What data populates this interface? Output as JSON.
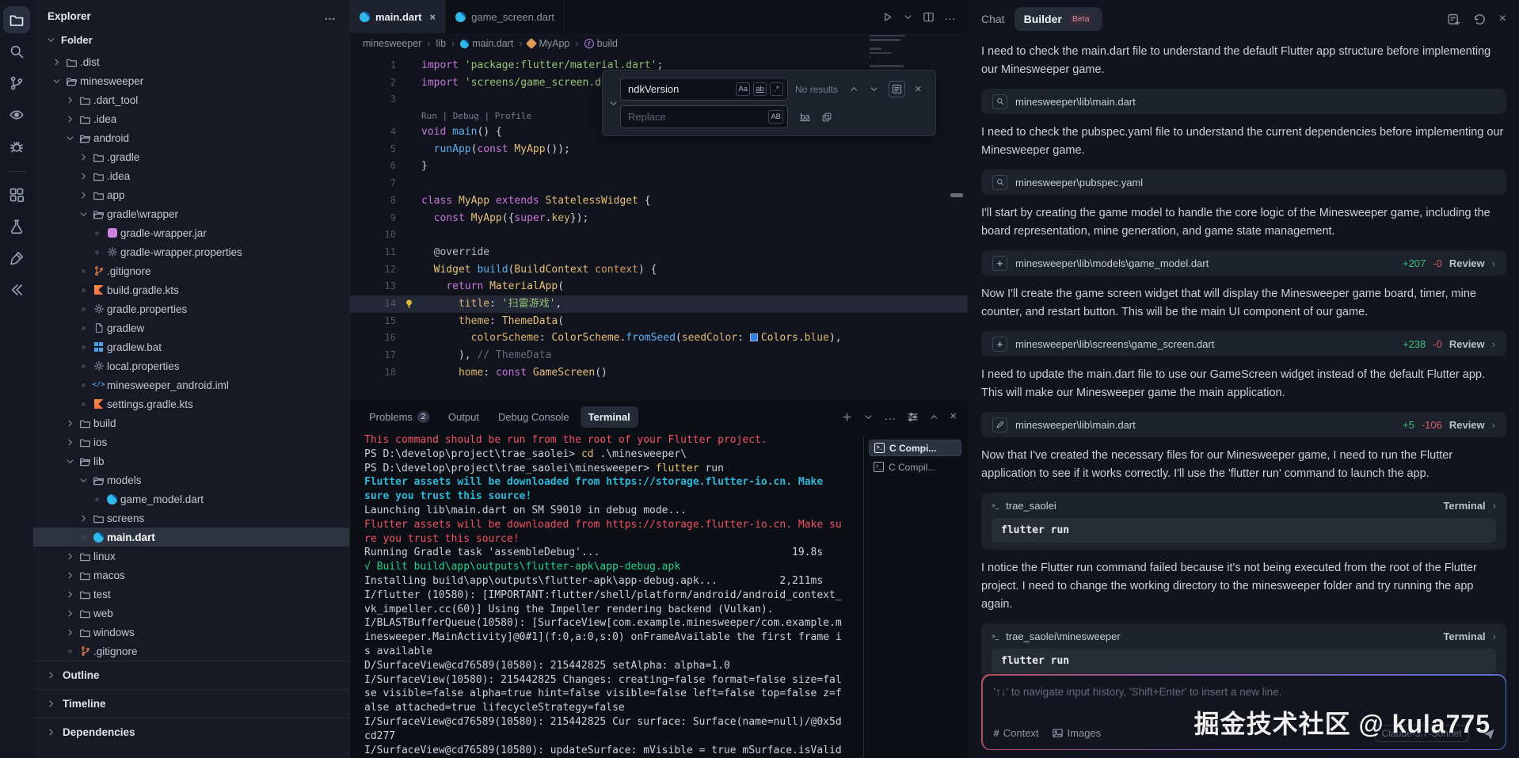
{
  "activity_bar": {
    "icons": [
      {
        "name": "explorer",
        "glyph": "files",
        "active": true
      },
      {
        "name": "search",
        "glyph": "search"
      },
      {
        "name": "source-control",
        "glyph": "git"
      },
      {
        "name": "preview",
        "glyph": "scan"
      },
      {
        "name": "debug",
        "glyph": "bug"
      },
      {
        "name": "divider",
        "glyph": "divider"
      },
      {
        "name": "extensions",
        "glyph": "grid"
      },
      {
        "name": "test-lab",
        "glyph": "flask"
      },
      {
        "name": "ai-stamp",
        "glyph": "stamp"
      },
      {
        "name": "flutter",
        "glyph": "flutchev"
      }
    ]
  },
  "sidebar": {
    "title": "Explorer",
    "more_label": "…",
    "section": "Folder",
    "tree": [
      {
        "d": 1,
        "icon": "folder",
        "chev": "r",
        "label": ".dist"
      },
      {
        "d": 1,
        "icon": "folderOpen",
        "chev": "d",
        "label": "minesweeper"
      },
      {
        "d": 2,
        "icon": "folder",
        "chev": "r",
        "label": ".dart_tool"
      },
      {
        "d": 2,
        "icon": "folder",
        "chev": "r",
        "label": ".idea"
      },
      {
        "d": 2,
        "icon": "folderOpen",
        "chev": "d",
        "label": "android"
      },
      {
        "d": 3,
        "icon": "folder",
        "chev": "r",
        "label": ".gradle"
      },
      {
        "d": 3,
        "icon": "folder",
        "chev": "r",
        "label": ".idea"
      },
      {
        "d": 3,
        "icon": "folder",
        "chev": "r",
        "label": "app"
      },
      {
        "d": 3,
        "icon": "folderOpen",
        "chev": "d",
        "label": "gradle\\wrapper"
      },
      {
        "d": 4,
        "icon": "jar",
        "dot": true,
        "label": "gradle-wrapper.jar"
      },
      {
        "d": 4,
        "icon": "gear",
        "dot": true,
        "label": "gradle-wrapper.properties"
      },
      {
        "d": 3,
        "icon": "gitf",
        "dot": true,
        "label": ".gitignore"
      },
      {
        "d": 3,
        "icon": "kotlin",
        "dot": true,
        "label": "build.gradle.kts"
      },
      {
        "d": 3,
        "icon": "gear",
        "dot": true,
        "label": "gradle.properties"
      },
      {
        "d": 3,
        "icon": "file",
        "dot": true,
        "label": "gradlew"
      },
      {
        "d": 3,
        "icon": "win",
        "dot": true,
        "label": "gradlew.bat"
      },
      {
        "d": 3,
        "icon": "gear",
        "dot": true,
        "label": "local.properties"
      },
      {
        "d": 3,
        "icon": "codef",
        "dot": true,
        "label": "minesweeper_android.iml"
      },
      {
        "d": 3,
        "icon": "kotlin",
        "dot": true,
        "label": "settings.gradle.kts"
      },
      {
        "d": 2,
        "icon": "folder",
        "chev": "r",
        "label": "build"
      },
      {
        "d": 2,
        "icon": "folder",
        "chev": "r",
        "label": "ios"
      },
      {
        "d": 2,
        "icon": "folderOpen",
        "chev": "d",
        "label": "lib"
      },
      {
        "d": 3,
        "icon": "folderOpen",
        "chev": "d",
        "label": "models"
      },
      {
        "d": 4,
        "icon": "dart",
        "dot": true,
        "label": "game_model.dart"
      },
      {
        "d": 3,
        "icon": "folder",
        "chev": "r",
        "label": "screens"
      },
      {
        "d": 3,
        "icon": "dart",
        "dot": true,
        "label": "main.dart",
        "selected": true
      },
      {
        "d": 2,
        "icon": "folder",
        "chev": "r",
        "label": "linux"
      },
      {
        "d": 2,
        "icon": "folder",
        "chev": "r",
        "label": "macos"
      },
      {
        "d": 2,
        "icon": "folder",
        "chev": "r",
        "label": "test"
      },
      {
        "d": 2,
        "icon": "folder",
        "chev": "r",
        "label": "web"
      },
      {
        "d": 2,
        "icon": "folder",
        "chev": "r",
        "label": "windows"
      },
      {
        "d": 2,
        "icon": "gitf",
        "dot": true,
        "label": ".gitignore"
      }
    ],
    "panels": [
      "Outline",
      "Timeline",
      "Dependencies"
    ]
  },
  "editor": {
    "tabs": [
      {
        "label": "main.dart",
        "active": true,
        "closable": true
      },
      {
        "label": "game_screen.dart",
        "active": false,
        "closable": false
      }
    ],
    "breadcrumb": [
      {
        "label": "minesweeper"
      },
      {
        "label": "lib"
      },
      {
        "label": "main.dart",
        "icon": "dart"
      },
      {
        "label": "MyApp",
        "icon": "class"
      },
      {
        "label": "build",
        "icon": "method"
      }
    ],
    "code_lens": "Run | Debug | Profile",
    "lines": [
      {
        "n": 1,
        "t": [
          [
            "kw",
            "import"
          ],
          [
            "pl",
            " "
          ],
          [
            "str",
            "'package:flutter/material.dart'"
          ],
          [
            "pl",
            ";"
          ]
        ]
      },
      {
        "n": 2,
        "t": [
          [
            "kw",
            "import"
          ],
          [
            "pl",
            " "
          ],
          [
            "str",
            "'screens/game_screen.dart'"
          ],
          [
            "pl",
            ";"
          ]
        ]
      },
      {
        "n": 3,
        "t": []
      },
      {
        "n": 4,
        "lens": true,
        "t": [
          [
            "kw",
            "void"
          ],
          [
            "pl",
            " "
          ],
          [
            "fn",
            "main"
          ],
          [
            "pl",
            "() {"
          ]
        ]
      },
      {
        "n": 5,
        "t": [
          [
            "pl",
            "  "
          ],
          [
            "fn",
            "runApp"
          ],
          [
            "pl",
            "("
          ],
          [
            "kw",
            "const"
          ],
          [
            "pl",
            " "
          ],
          [
            "cls",
            "MyApp"
          ],
          [
            "pl",
            "());"
          ]
        ]
      },
      {
        "n": 6,
        "t": [
          [
            "pl",
            "}"
          ]
        ]
      },
      {
        "n": 7,
        "t": []
      },
      {
        "n": 8,
        "t": [
          [
            "kw",
            "class"
          ],
          [
            "pl",
            " "
          ],
          [
            "cls",
            "MyApp"
          ],
          [
            "pl",
            " "
          ],
          [
            "kw",
            "extends"
          ],
          [
            "pl",
            " "
          ],
          [
            "cls",
            "StatelessWidget"
          ],
          [
            "pl",
            " {"
          ]
        ]
      },
      {
        "n": 9,
        "t": [
          [
            "pl",
            "  "
          ],
          [
            "kw",
            "const"
          ],
          [
            "pl",
            " "
          ],
          [
            "cls",
            "MyApp"
          ],
          [
            "pl",
            "({"
          ],
          [
            "kw",
            "super"
          ],
          [
            "pl",
            "."
          ],
          [
            "prop",
            "key"
          ],
          [
            "pl",
            "});"
          ]
        ]
      },
      {
        "n": 10,
        "t": []
      },
      {
        "n": 11,
        "t": [
          [
            "pl",
            "  "
          ],
          [
            "ann",
            "@override"
          ]
        ]
      },
      {
        "n": 12,
        "t": [
          [
            "pl",
            "  "
          ],
          [
            "cls",
            "Widget"
          ],
          [
            "pl",
            " "
          ],
          [
            "fn",
            "build"
          ],
          [
            "pl",
            "("
          ],
          [
            "cls",
            "BuildContext"
          ],
          [
            "pl",
            " "
          ],
          [
            "var",
            "context"
          ],
          [
            "pl",
            ") {"
          ]
        ]
      },
      {
        "n": 13,
        "t": [
          [
            "pl",
            "    "
          ],
          [
            "kw",
            "return"
          ],
          [
            "pl",
            " "
          ],
          [
            "cls",
            "MaterialApp"
          ],
          [
            "pl",
            "("
          ]
        ]
      },
      {
        "n": 14,
        "hl": true,
        "t": [
          [
            "pl",
            "      "
          ],
          [
            "prop",
            "title"
          ],
          [
            "pl",
            ": "
          ],
          [
            "str",
            "'扫雷游戏'"
          ],
          [
            "pl",
            ","
          ]
        ]
      },
      {
        "n": 15,
        "t": [
          [
            "pl",
            "      "
          ],
          [
            "prop",
            "theme"
          ],
          [
            "pl",
            ": "
          ],
          [
            "cls",
            "ThemeData"
          ],
          [
            "pl",
            "("
          ]
        ]
      },
      {
        "n": 16,
        "t": [
          [
            "pl",
            "        "
          ],
          [
            "prop",
            "colorScheme"
          ],
          [
            "pl",
            ": "
          ],
          [
            "cls",
            "ColorScheme"
          ],
          [
            "pl",
            "."
          ],
          [
            "fn",
            "fromSeed"
          ],
          [
            "pl",
            "("
          ],
          [
            "prop",
            "seedColor"
          ],
          [
            "pl",
            ": "
          ],
          [
            "sw",
            ""
          ],
          [
            "cls",
            "Colors"
          ],
          [
            "pl",
            "."
          ],
          [
            "prop",
            "blue"
          ],
          [
            "pl",
            "),"
          ]
        ]
      },
      {
        "n": 17,
        "t": [
          [
            "pl",
            "      "
          ],
          [
            "pl",
            "), "
          ],
          [
            "cmt",
            "// ThemeData"
          ]
        ]
      },
      {
        "n": 18,
        "t": [
          [
            "pl",
            "      "
          ],
          [
            "prop",
            "home"
          ],
          [
            "pl",
            ": "
          ],
          [
            "kw",
            "const"
          ],
          [
            "pl",
            " "
          ],
          [
            "cls",
            "GameScreen"
          ],
          [
            "pl",
            "()"
          ]
        ]
      }
    ]
  },
  "find_widget": {
    "query": "ndkVersion",
    "toggles": [
      "Aa",
      "ab",
      ".*"
    ],
    "results": "No results",
    "replace_placeholder": "Replace",
    "replace_toggle": "AB",
    "replace_icon_label": "ba"
  },
  "terminal": {
    "tabs": [
      {
        "label": "Problems",
        "badge": "2"
      },
      {
        "label": "Output"
      },
      {
        "label": "Debug Console"
      },
      {
        "label": "Terminal",
        "active": true
      }
    ],
    "sessions": [
      {
        "label": "C Compi...",
        "selected": true
      },
      {
        "label": "C Compil...",
        "selected": false
      }
    ],
    "lines": [
      [
        [
          "red",
          "This command should be run from the root of your Flutter project."
        ]
      ],
      [
        [
          "pl",
          "PS D:\\develop\\project\\trae_saolei> "
        ],
        [
          "yel",
          "cd"
        ],
        [
          "pl",
          " .\\minesweeper\\"
        ]
      ],
      [
        [
          "pl",
          "PS D:\\develop\\project\\trae_saolei\\minesweeper> "
        ],
        [
          "yel",
          "flutter"
        ],
        [
          "pl",
          " run"
        ]
      ],
      [
        [
          "cyan",
          "Flutter assets will be downloaded from https://storage.flutter-io.cn. Make"
        ]
      ],
      [
        [
          "cyan",
          "sure you trust this source!"
        ]
      ],
      [
        [
          "pl",
          "Launching lib\\main.dart on SM S9010 in debug mode..."
        ]
      ],
      [
        [
          "red",
          "Flutter assets will be downloaded from https://storage.flutter-io.cn. Make su"
        ]
      ],
      [
        [
          "red",
          "re you trust this source!"
        ]
      ],
      [
        [
          "pl",
          "Running Gradle task 'assembleDebug'...                               19.8s"
        ]
      ],
      [
        [
          "grn",
          "√ Built build\\app\\outputs\\flutter-apk\\app-debug.apk"
        ]
      ],
      [
        [
          "pl",
          "Installing build\\app\\outputs\\flutter-apk\\app-debug.apk...          2,211ms"
        ]
      ],
      [
        [
          "pl",
          "I/flutter (10580): [IMPORTANT:flutter/shell/platform/android/android_context_"
        ]
      ],
      [
        [
          "pl",
          "vk_impeller.cc(60)] Using the Impeller rendering backend (Vulkan)."
        ]
      ],
      [
        [
          "pl",
          "I/BLASTBufferQueue(10580): [SurfaceView[com.example.minesweeper/com.example.m"
        ]
      ],
      [
        [
          "pl",
          "inesweeper.MainActivity]@0#1](f:0,a:0,s:0) onFrameAvailable the first frame i"
        ]
      ],
      [
        [
          "pl",
          "s available"
        ]
      ],
      [
        [
          "pl",
          "D/SurfaceView@cd76589(10580): 215442825 setAlpha: alpha=1.0"
        ]
      ],
      [
        [
          "pl",
          "I/SurfaceView(10580): 215442825 Changes: creating=false format=false size=fal"
        ]
      ],
      [
        [
          "pl",
          "se visible=false alpha=true hint=false visible=false left=false top=false z=f"
        ]
      ],
      [
        [
          "pl",
          "alse attached=true lifecycleStrategy=false"
        ]
      ],
      [
        [
          "pl",
          "I/SurfaceView@cd76589(10580): 215442825 Cur surface: Surface(name=null)/@0x5d"
        ]
      ],
      [
        [
          "pl",
          "cd277"
        ]
      ],
      [
        [
          "pl",
          "I/SurfaceView@cd76589(10580): updateSurface: mVisible = true mSurface.isValid"
        ]
      ]
    ]
  },
  "chat": {
    "tab_chat": "Chat",
    "tab_builder": "Builder",
    "beta": "Beta",
    "items": [
      {
        "type": "text",
        "text": "I need to check the main.dart file to understand the default Flutter app structure before implementing our Minesweeper game."
      },
      {
        "type": "file",
        "icon": "search",
        "path": "minesweeper\\lib\\main.dart"
      },
      {
        "type": "text",
        "text": "I need to check the pubspec.yaml file to understand the current dependencies before implementing our Minesweeper game."
      },
      {
        "type": "file",
        "icon": "search",
        "path": "minesweeper\\pubspec.yaml"
      },
      {
        "type": "text",
        "text": "I'll start by creating the game model to handle the core logic of the Minesweeper game, including the board representation, mine generation, and game state management."
      },
      {
        "type": "file",
        "icon": "add",
        "path": "minesweeper\\lib\\models\\game_model.dart",
        "added": "+207",
        "removed": "-0",
        "action": "Review"
      },
      {
        "type": "text",
        "text": "Now I'll create the game screen widget that will display the Minesweeper game board, timer, mine counter, and restart button. This will be the main UI component of our game."
      },
      {
        "type": "file",
        "icon": "add",
        "path": "minesweeper\\lib\\screens\\game_screen.dart",
        "added": "+238",
        "removed": "-0",
        "action": "Review"
      },
      {
        "type": "text",
        "text": "I need to update the main.dart file to use our GameScreen widget instead of the default Flutter app. This will make our Minesweeper game the main application."
      },
      {
        "type": "file",
        "icon": "edit",
        "path": "minesweeper\\lib\\main.dart",
        "added": "+5",
        "removed": "-106",
        "action": "Review"
      },
      {
        "type": "text",
        "text": "Now that I've created the necessary files for our Minesweeper game, I need to run the Flutter application to see if it works correctly. I'll use the 'flutter run' command to launch the app."
      },
      {
        "type": "terminal",
        "name": "trae_saolei",
        "action": "Terminal",
        "command": "flutter run"
      },
      {
        "type": "text",
        "text": "I notice the Flutter run command failed because it's not being executed from the root of the Flutter project. I need to change the working directory to the minesweeper folder and try running the app again."
      },
      {
        "type": "terminal",
        "name": "trae_saolei\\minesweeper",
        "action": "Terminal",
        "command": "flutter run"
      }
    ],
    "input": {
      "placeholder": "'↑↓' to navigate input history, 'Shift+Enter' to insert a new line.",
      "context_label": "Context",
      "images_label": "Images",
      "model": "Claude-3.7-Sonnet"
    }
  },
  "watermark": "掘金技术社区 @ kula775"
}
